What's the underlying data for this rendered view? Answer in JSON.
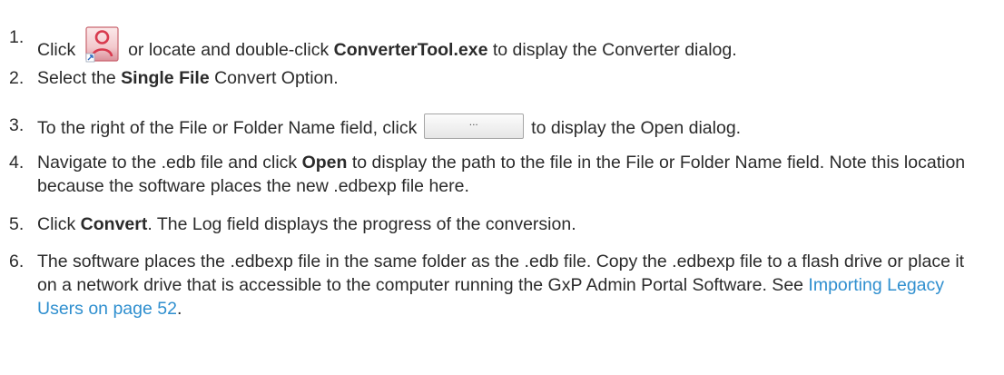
{
  "steps": [
    {
      "number": "1.",
      "t1": "Click ",
      "t2": " or locate and double-click ",
      "b1": "ConverterTool.exe",
      "t3": " to display the Converter dialog.",
      "icon": "converter-tool-icon"
    },
    {
      "number": "2.",
      "t1": "Select the ",
      "b1": "Single File",
      "t2": " Convert Option."
    },
    {
      "number": "3.",
      "t1": "To the right of the File or Folder Name field, click ",
      "button_label": "...",
      "t2": " to display the Open dialog."
    },
    {
      "number": "4.",
      "t1": "Navigate to the .edb file and click ",
      "b1": "Open",
      "t2": " to display the path to the file in the File or Folder Name field. Note this location because the software places the new .edbexp file here."
    },
    {
      "number": "5.",
      "t1": "Click ",
      "b1": "Convert",
      "t2": ". The Log field displays the progress of the conversion."
    },
    {
      "number": "6.",
      "t1": "The software places the .edbexp file in the same folder as the .edb file. Copy the .edbexp file to a flash drive or place it on a network drive that is accessible to the computer running the GxP Admin Portal Software. See ",
      "link": "Importing Legacy Users on page 52",
      "t2": "."
    }
  ],
  "colors": {
    "text": "#2b2b2b",
    "link": "#2f8fcf",
    "icon_frame": "#e05a6a"
  }
}
